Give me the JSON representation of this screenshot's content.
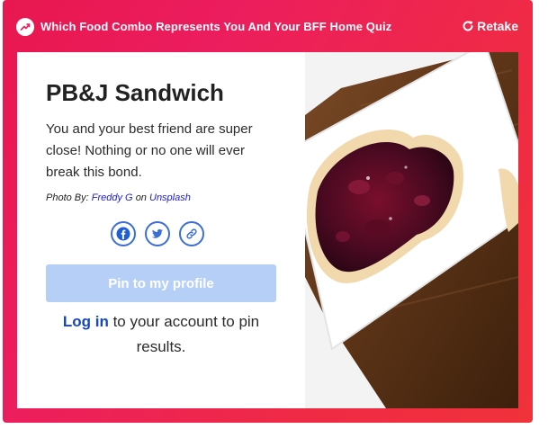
{
  "header": {
    "quiz_title": "Which Food Combo Represents You And Your BFF Home Quiz",
    "retake_label": "Retake"
  },
  "result": {
    "title": "PB&J Sandwich",
    "description": "You and your best friend are super close! Nothing or no one will ever break this bond.",
    "credit": {
      "prefix": "Photo By:",
      "author": "Freddy G",
      "separator": "on",
      "source": "Unsplash"
    }
  },
  "share": [
    {
      "name": "facebook-icon"
    },
    {
      "name": "twitter-icon"
    },
    {
      "name": "copy-link-icon"
    }
  ],
  "pin_label": "Pin to my profile",
  "login": {
    "link_label": "Log in",
    "suffix": "to your account to pin results."
  },
  "colors": {
    "brand_gradient_start": "#e8174f",
    "brand_gradient_end": "#f0323a",
    "link": "#1546c9",
    "pin_disabled": "#b6cff7",
    "share_outline": "#3b6fd6"
  }
}
